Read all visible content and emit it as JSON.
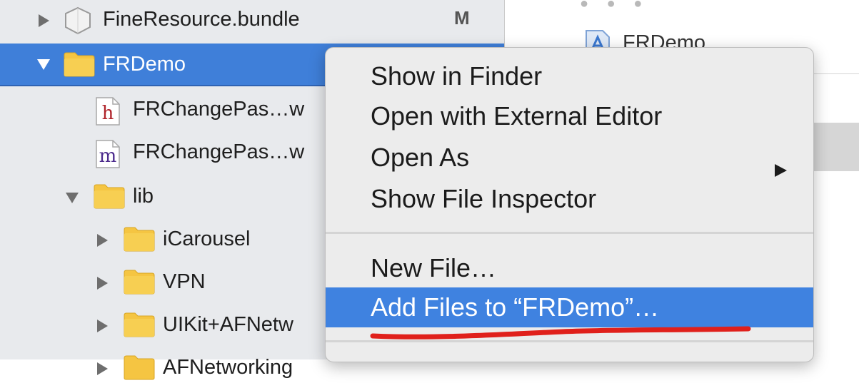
{
  "navigator": {
    "items": [
      {
        "label": "FineResource.bundle",
        "badge": "M",
        "kind": "bundle",
        "expanded": false
      },
      {
        "label": "FRDemo",
        "kind": "folder",
        "expanded": true,
        "selected": true
      },
      {
        "label": "FRChangePas…w",
        "kind": "header-file",
        "icon_letter": "h"
      },
      {
        "label": "FRChangePas…w",
        "kind": "implementation-file",
        "icon_letter": "m"
      },
      {
        "label": "lib",
        "kind": "folder",
        "expanded": true
      },
      {
        "label": "iCarousel",
        "kind": "folder",
        "expanded": false
      },
      {
        "label": "VPN",
        "kind": "folder",
        "expanded": false
      },
      {
        "label": "UIKit+AFNetw",
        "kind": "folder",
        "expanded": false
      },
      {
        "label": "AFNetworking",
        "kind": "folder",
        "expanded": false
      }
    ]
  },
  "editor": {
    "tab_label": "FRDemo"
  },
  "context_menu": {
    "items": [
      {
        "label": "Show in Finder"
      },
      {
        "label": "Open with External Editor"
      },
      {
        "label": "Open As",
        "has_submenu": true
      },
      {
        "label": "Show File Inspector"
      },
      {
        "label": "New File…"
      },
      {
        "label": "Add Files to “FRDemo”…",
        "highlighted": true
      }
    ]
  },
  "colors": {
    "selection_blue": "#3f7fd9",
    "menu_highlight": "#3f82e0",
    "folder_yellow": "#f5c542",
    "annotation_red": "#e0201b"
  }
}
